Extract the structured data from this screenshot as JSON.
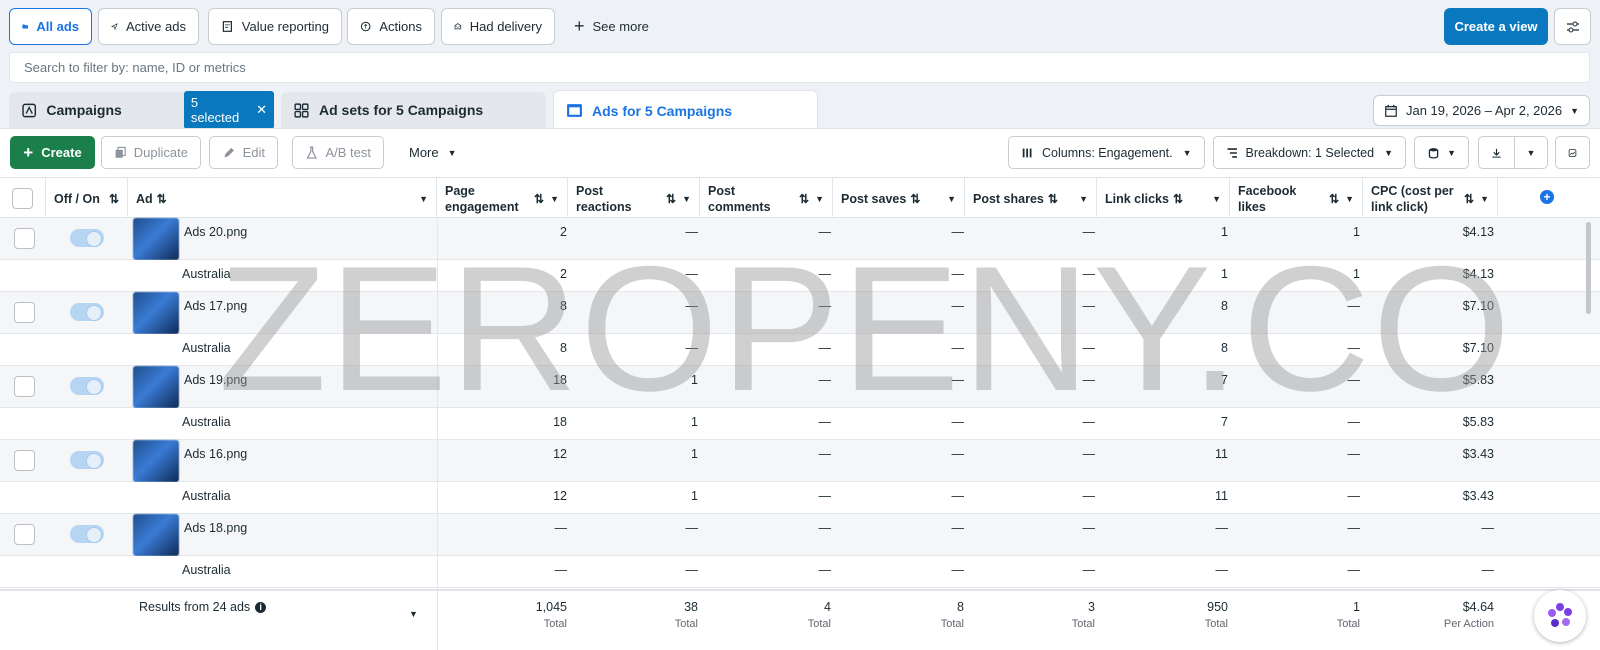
{
  "views": {
    "all_ads": "All ads",
    "active_ads": "Active ads",
    "value_reporting": "Value reporting",
    "actions": "Actions",
    "had_delivery": "Had delivery",
    "see_more": "See more",
    "create_view": "Create a view"
  },
  "search": {
    "placeholder": "Search to filter by: name, ID or metrics"
  },
  "tabs": {
    "campaigns": "Campaigns",
    "selected_badge": "5 selected",
    "ad_sets": "Ad sets for 5 Campaigns",
    "ads": "Ads for 5 Campaigns"
  },
  "date_range": "Jan 19, 2026 – Apr 2, 2026",
  "toolbar": {
    "create": "Create",
    "duplicate": "Duplicate",
    "edit": "Edit",
    "ab_test": "A/B test",
    "more": "More",
    "columns": "Columns: Engagement.",
    "breakdown": "Breakdown: 1 Selected"
  },
  "columns": {
    "off_on": "Off / On",
    "ad": "Ad",
    "page_engagement": "Page engagement",
    "post_reactions": "Post reactions",
    "post_comments": "Post comments",
    "post_saves": "Post saves",
    "post_shares": "Post shares",
    "link_clicks": "Link clicks",
    "facebook_likes": "Facebook likes",
    "cpc": "CPC (cost per link click)"
  },
  "rows": [
    {
      "name": "Ads 20.png",
      "cells": [
        "2",
        "—",
        "—",
        "—",
        "—",
        "1",
        "1",
        "$4.13"
      ]
    },
    {
      "name": "Australia",
      "cells": [
        "2",
        "—",
        "—",
        "—",
        "—",
        "1",
        "1",
        "$4.13"
      ]
    },
    {
      "name": "Ads 17.png",
      "cells": [
        "8",
        "—",
        "—",
        "—",
        "—",
        "8",
        "—",
        "$7.10"
      ]
    },
    {
      "name": "Australia",
      "cells": [
        "8",
        "—",
        "—",
        "—",
        "—",
        "8",
        "—",
        "$7.10"
      ]
    },
    {
      "name": "Ads 19.png",
      "cells": [
        "18",
        "1",
        "—",
        "—",
        "—",
        "7",
        "—",
        "$5.83"
      ]
    },
    {
      "name": "Australia",
      "cells": [
        "18",
        "1",
        "—",
        "—",
        "—",
        "7",
        "—",
        "$5.83"
      ]
    },
    {
      "name": "Ads 16.png",
      "cells": [
        "12",
        "1",
        "—",
        "—",
        "—",
        "11",
        "—",
        "$3.43"
      ]
    },
    {
      "name": "Australia",
      "cells": [
        "12",
        "1",
        "—",
        "—",
        "—",
        "11",
        "—",
        "$3.43"
      ]
    },
    {
      "name": "Ads 18.png",
      "cells": [
        "—",
        "—",
        "—",
        "—",
        "—",
        "—",
        "—",
        "—"
      ]
    },
    {
      "name": "Australia",
      "cells": [
        "—",
        "—",
        "—",
        "—",
        "—",
        "—",
        "—",
        "—"
      ]
    }
  ],
  "footer": {
    "results": "Results from 24 ads",
    "values": [
      "1,045",
      "38",
      "4",
      "8",
      "3",
      "950",
      "1",
      "$4.64"
    ],
    "labels": [
      "Total",
      "Total",
      "Total",
      "Total",
      "Total",
      "Total",
      "Total",
      "Per Action"
    ]
  },
  "watermark": "ZEROPENY.CO"
}
